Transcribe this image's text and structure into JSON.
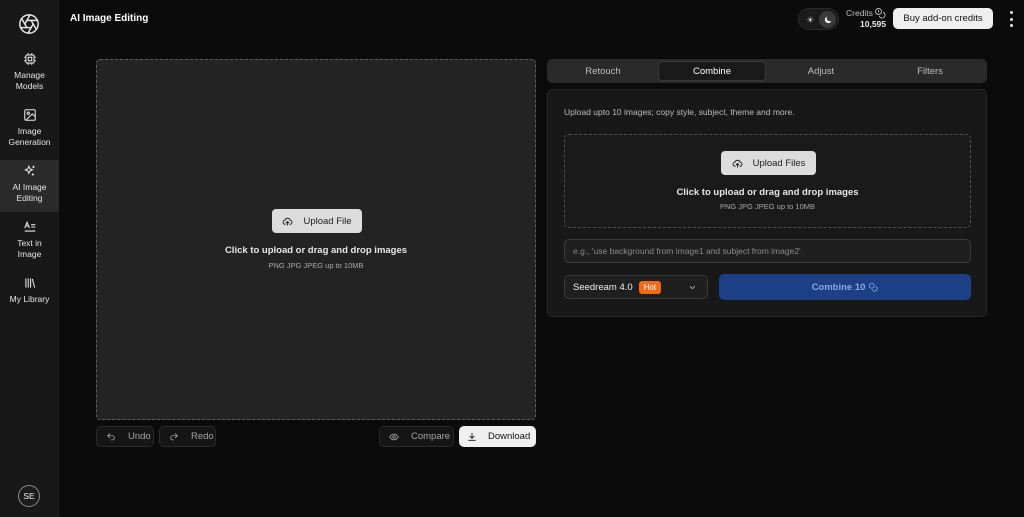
{
  "app": {
    "title": "AI Image Editing"
  },
  "sidebar": {
    "items": [
      {
        "line1": "Manage",
        "line2": "Models",
        "icon": "chip-icon"
      },
      {
        "line1": "Image",
        "line2": "Generation",
        "icon": "image-icon"
      },
      {
        "line1": "AI Image",
        "line2": "Editing",
        "icon": "sparkles-icon"
      },
      {
        "line1": "Text in",
        "line2": "Image",
        "icon": "text-icon"
      },
      {
        "line1": "My Library",
        "line2": "",
        "icon": "library-icon"
      }
    ],
    "active": "AI Image Editing",
    "avatar_initials": "SE"
  },
  "header": {
    "credits_label": "Credits",
    "credits_value": "10,595",
    "buy_label": "Buy add-on credits",
    "theme": "dark"
  },
  "canvas": {
    "upload_label": "Upload File",
    "main_text": "Click to upload or drag and drop images",
    "sub_text": "PNG JPG JPEG up to 10MB"
  },
  "toolbar": {
    "undo_label": "Undo",
    "redo_label": "Redo",
    "compare_label": "Compare",
    "download_label": "Download"
  },
  "tabs": [
    {
      "label": "Retouch"
    },
    {
      "label": "Combine"
    },
    {
      "label": "Adjust"
    },
    {
      "label": "Filters"
    }
  ],
  "active_tab": "Combine",
  "panel": {
    "description": "Upload upto 10 images; copy style, subject, theme and more.",
    "upload_label": "Upload Files",
    "main_text": "Click to upload or drag and drop images",
    "sub_text": "PNG JPG JPEG up to 10MB",
    "prompt_placeholder": "e.g., 'use background from image1 and subject from image2'",
    "model_name": "Seedream 4.0",
    "model_badge": "Hot",
    "combine_label": "Combine 10"
  },
  "colors": {
    "accent_button": "#1c3f86",
    "hot_badge": "#f06a1a",
    "background": "#0b0b0b"
  }
}
